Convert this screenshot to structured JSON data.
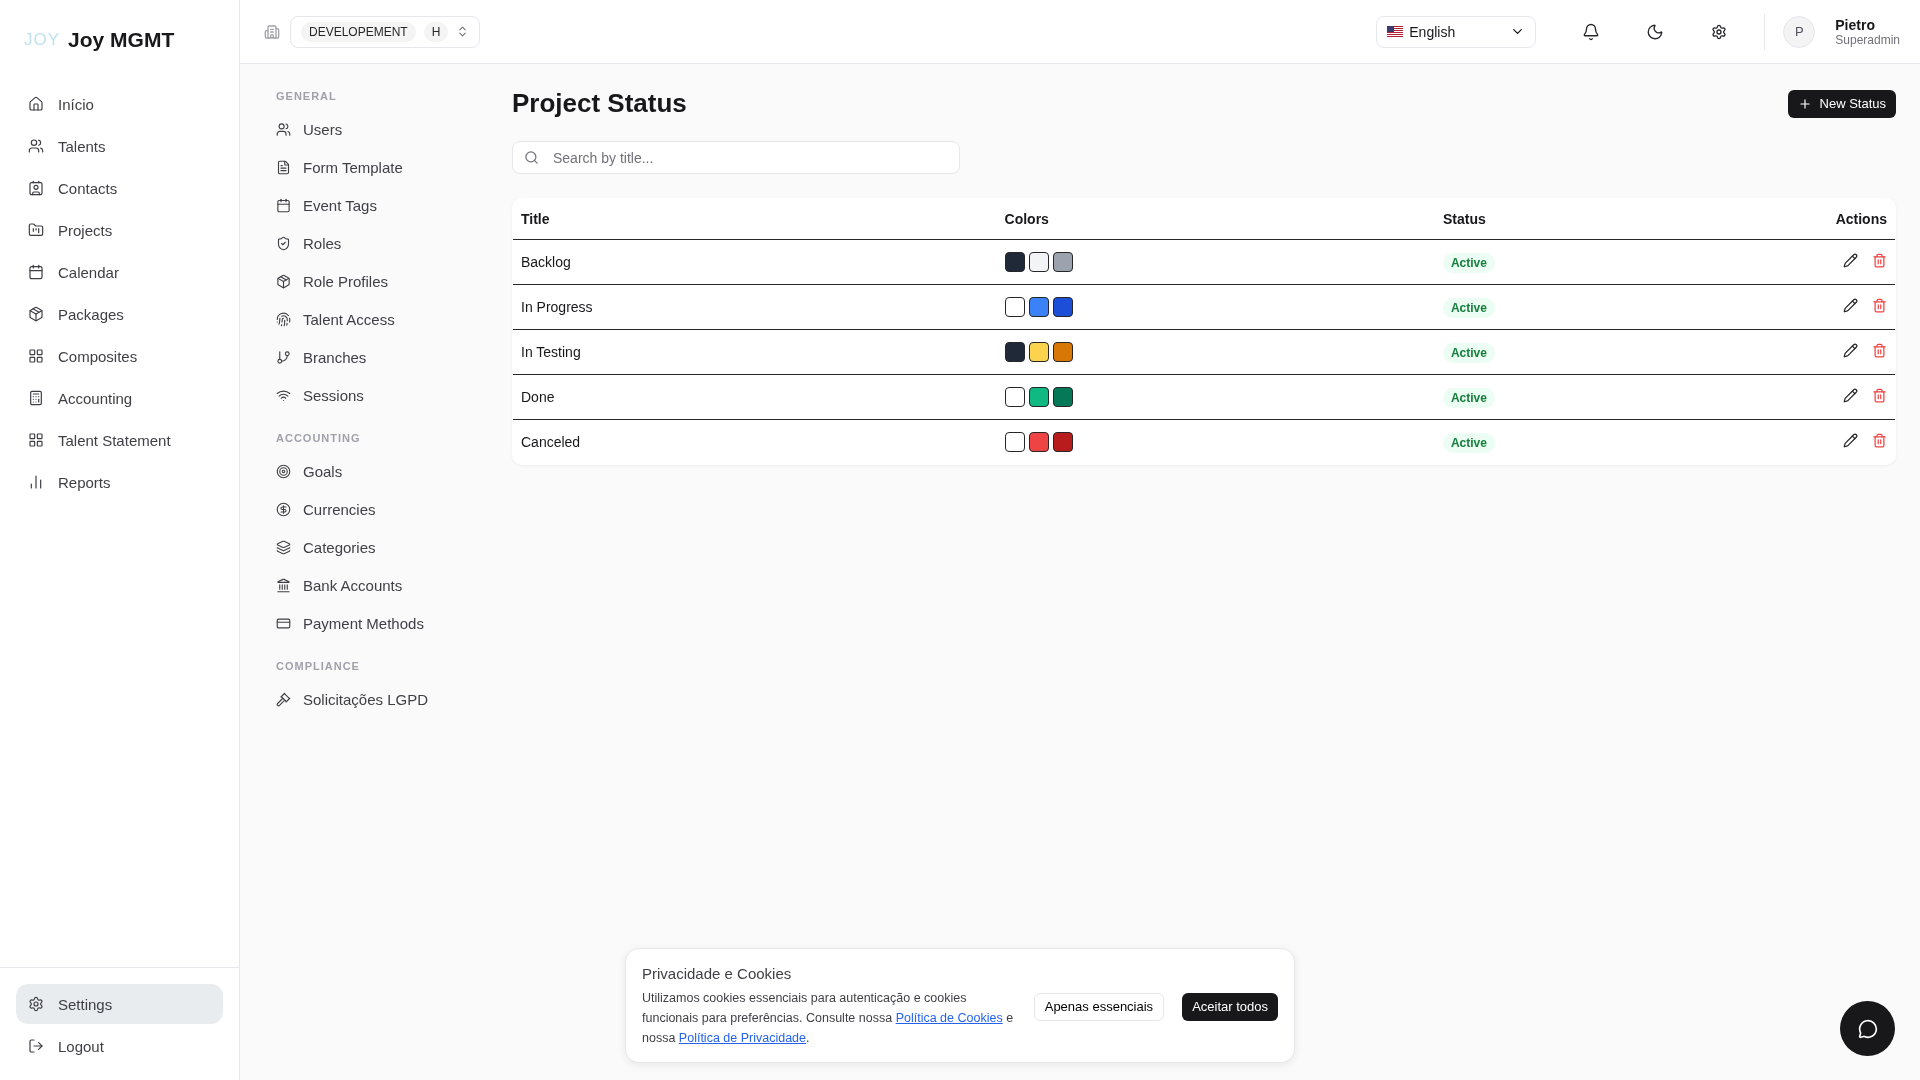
{
  "brand": {
    "mark": "JOY",
    "name": "Joy MGMT"
  },
  "sidebar": {
    "items": [
      {
        "label": "Início",
        "selected": false
      },
      {
        "label": "Talents",
        "selected": false
      },
      {
        "label": "Contacts",
        "selected": false
      },
      {
        "label": "Projects",
        "selected": false
      },
      {
        "label": "Calendar",
        "selected": false
      },
      {
        "label": "Packages",
        "selected": false
      },
      {
        "label": "Composites",
        "selected": false
      },
      {
        "label": "Accounting",
        "selected": false
      },
      {
        "label": "Talent Statement",
        "selected": false
      },
      {
        "label": "Reports",
        "selected": false
      }
    ],
    "bottom": [
      {
        "label": "Settings",
        "selected": true
      },
      {
        "label": "Logout",
        "selected": false
      }
    ]
  },
  "topbar": {
    "environment": "DEVELOPEMENT",
    "environment_tag": "H",
    "language": "English",
    "user": {
      "initial": "P",
      "name": "Pietro",
      "role": "Superadmin"
    }
  },
  "settings_nav": [
    {
      "heading": "GENERAL",
      "items": [
        "Users",
        "Form Template",
        "Event Tags",
        "Roles",
        "Role Profiles",
        "Talent Access",
        "Branches",
        "Sessions"
      ]
    },
    {
      "heading": "ACCOUNTING",
      "items": [
        "Goals",
        "Currencies",
        "Categories",
        "Bank Accounts",
        "Payment Methods"
      ]
    },
    {
      "heading": "COMPLIANCE",
      "items": [
        "Solicitações LGPD"
      ]
    }
  ],
  "page": {
    "title": "Project Status",
    "new_button": "New Status",
    "search": {
      "placeholder": "Search by title..."
    }
  },
  "table": {
    "columns": [
      "Title",
      "Colors",
      "Status",
      "Actions"
    ],
    "rows": [
      {
        "title": "Backlog",
        "swatches": [
          {
            "color": "#1f2937"
          },
          {
            "color": "#f3f4f6"
          },
          {
            "color": "#9ca3af"
          }
        ],
        "status": "Active"
      },
      {
        "title": "In Progress",
        "swatches": [
          {
            "color": "#ffffff"
          },
          {
            "color": "#3b82f6"
          },
          {
            "color": "#1d4ed8"
          }
        ],
        "status": "Active"
      },
      {
        "title": "In Testing",
        "swatches": [
          {
            "color": "#1f2937"
          },
          {
            "color": "#fcd34d"
          },
          {
            "color": "#d97706"
          }
        ],
        "status": "Active"
      },
      {
        "title": "Done",
        "swatches": [
          {
            "color": "#ffffff"
          },
          {
            "color": "#10b981"
          },
          {
            "color": "#047857"
          }
        ],
        "status": "Active"
      },
      {
        "title": "Canceled",
        "swatches": [
          {
            "color": "#ffffff"
          },
          {
            "color": "#ef4444"
          },
          {
            "color": "#b91c1c"
          }
        ],
        "status": "Active"
      }
    ]
  },
  "cookie_banner": {
    "title": "Privacidade e Cookies",
    "text_before": "Utilizamos cookies essenciais para autenticação e cookies funcionais para preferências. Consulte nossa",
    "link_cookies": "Política de Cookies",
    "text_middle": "e nossa",
    "link_privacy": "Política de Privacidade",
    "text_after": ".",
    "buttons": [
      "Apenas essenciais",
      "Aceitar todos"
    ]
  }
}
